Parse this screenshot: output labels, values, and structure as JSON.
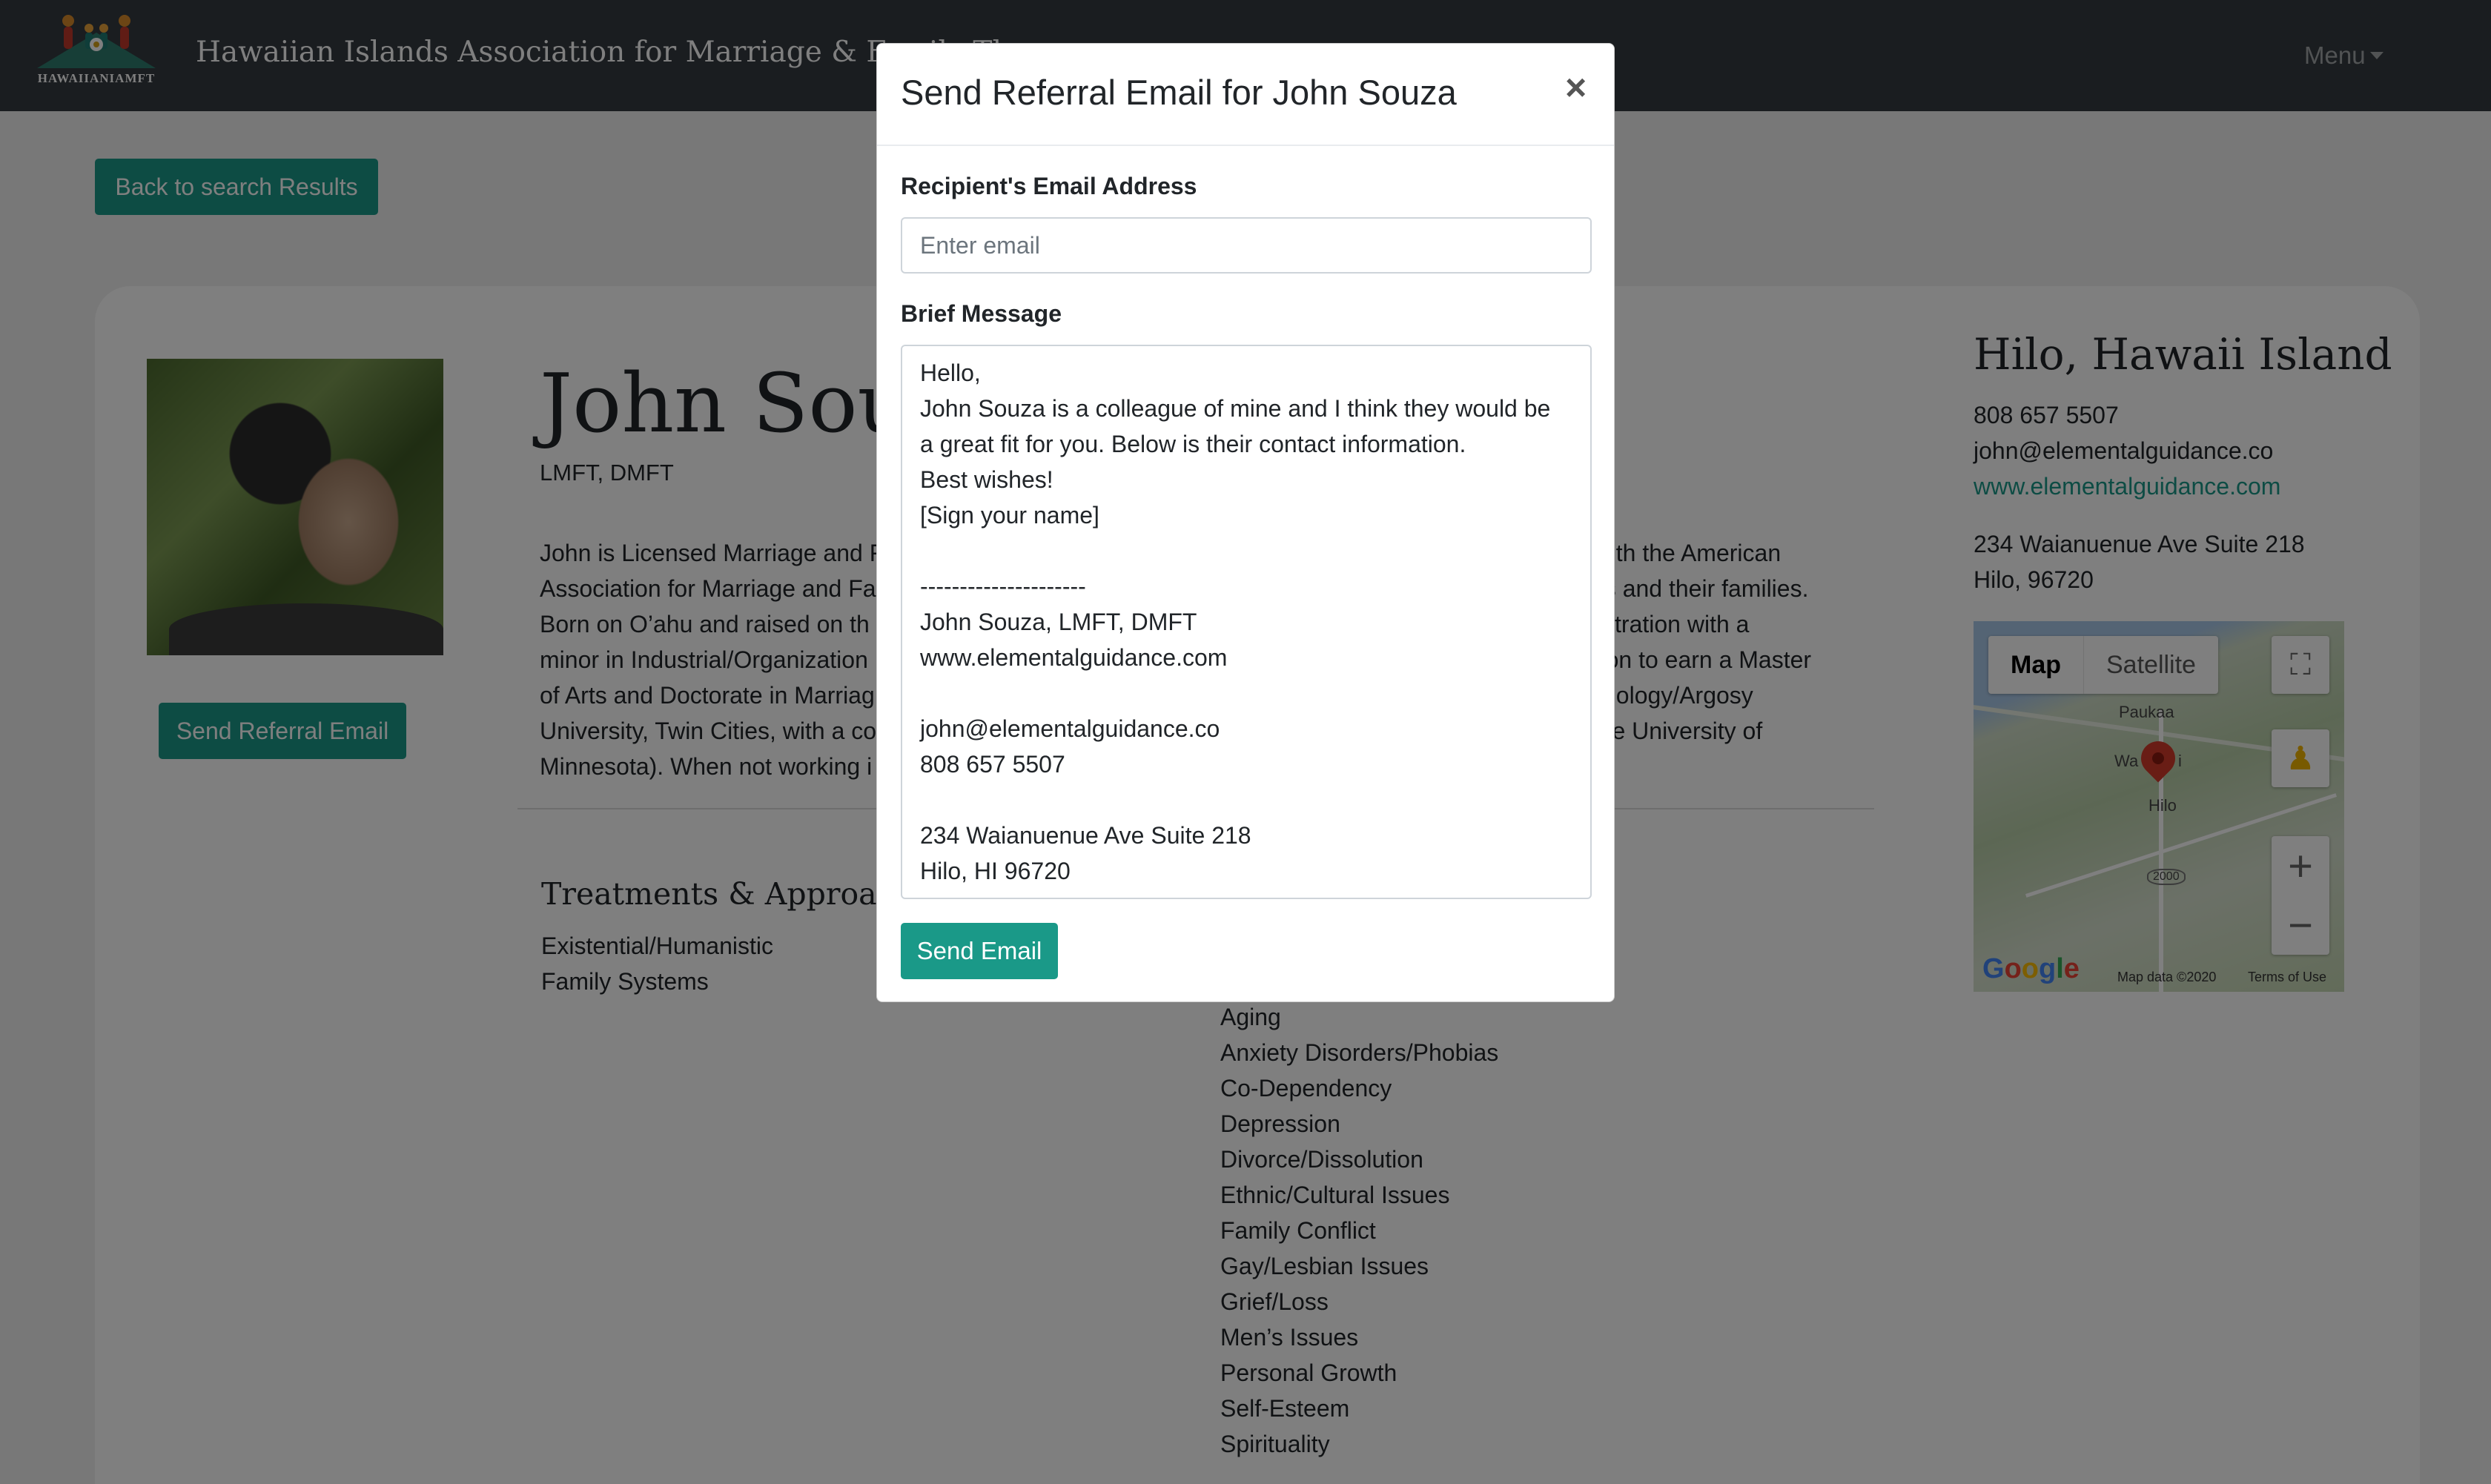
{
  "navbar": {
    "logo_text": "HAWAIIANIAMFT",
    "brand": "Hawaiian Islands Association for Marriage & Family Therapy",
    "menu_label": "Menu"
  },
  "page": {
    "back_button": "Back to search Results",
    "referral_button": "Send Referral Email",
    "name": "John Souza",
    "credentials": "LMFT, DMFT",
    "bio_left": "John is Licensed Marriage and F\nAssociation for Marriage and Fa\nBorn on O’ahu and raised on th\nminor in Industrial/Organization\nof Arts and Doctorate in Marriag\nUniversity, Twin Cities, with a co\nMinnesota). When not working i",
    "bio_right": "r with the American\nults and their families.\ninistration with a\nnt on to earn a Master\nychology/Argosy\nt the University of",
    "treatments_heading": "Treatments & Approaches",
    "treatments": [
      "Existential/Humanistic",
      "Family Systems"
    ],
    "issues": [
      "Aging",
      "Anxiety Disorders/Phobias",
      "Co-Dependency",
      "Depression",
      "Divorce/Dissolution",
      "Ethnic/Cultural Issues",
      "Family Conflict",
      "Gay/Lesbian Issues",
      "Grief/Loss",
      "Men’s Issues",
      "Personal Growth",
      "Self-Esteem",
      "Spirituality"
    ],
    "location_title": "Hilo, Hawaii Island",
    "phone": "808 657 5507",
    "email": "john@elementalguidance.co",
    "website": "www.elementalguidance.com",
    "address_line1": "234 Waianuenue Ave Suite 218",
    "address_line2": "Hilo, 96720"
  },
  "map": {
    "tab_map": "Map",
    "tab_satellite": "Satellite",
    "label_paukaa": "Paukaa",
    "label_wa": "Wa",
    "label_wa_end": "i",
    "label_hilo": "Hilo",
    "label_route": "2000",
    "zoom_in": "+",
    "zoom_out": "−",
    "map_data": "Map data ©2020",
    "terms": "Terms of Use",
    "icons": [
      "fullscreen-icon",
      "pegman-icon",
      "map-pin-icon"
    ]
  },
  "modal": {
    "title": "Send Referral Email for John Souza",
    "close": "×",
    "email_label": "Recipient's Email Address",
    "email_placeholder": "Enter email",
    "email_value": "",
    "message_label": "Brief Message",
    "message_value": "Hello,\nJohn Souza is a colleague of mine and I think they would be\na great fit for you. Below is their contact information.\nBest wishes!\n[Sign your name]\n\n---------------------\nJohn Souza, LMFT, DMFT\nwww.elementalguidance.com\n\njohn@elementalguidance.co\n808 657 5507\n\n234 Waianuenue Ave Suite 218\nHilo, HI 96720",
    "send_button": "Send Email"
  },
  "colors": {
    "navbar": "#343a40",
    "accent": "#1a9988",
    "link": "#1a9988"
  }
}
